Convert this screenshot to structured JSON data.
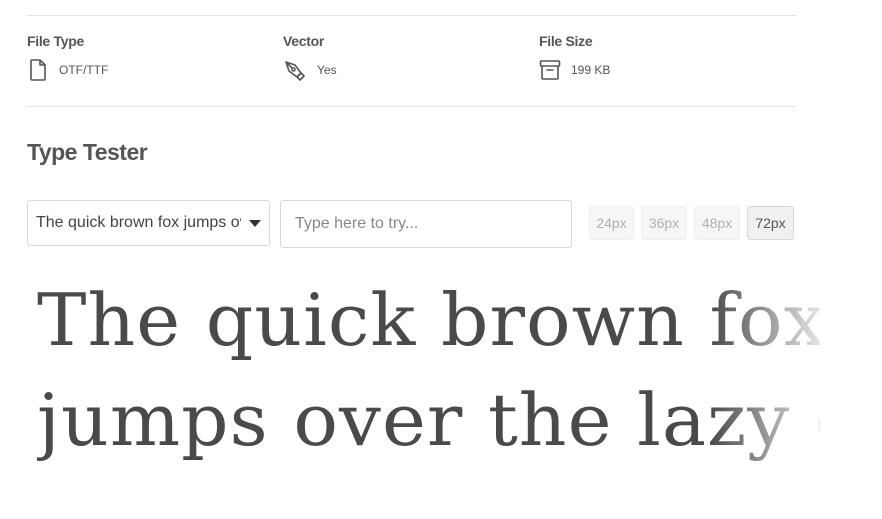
{
  "meta": {
    "file_type": {
      "label": "File Type",
      "value": "OTF/TTF",
      "icon": "file-icon"
    },
    "vector": {
      "label": "Vector",
      "value": "Yes",
      "icon": "pen-tool-icon"
    },
    "file_size": {
      "label": "File Size",
      "value": "199 KB",
      "icon": "archive-box-icon"
    }
  },
  "type_tester": {
    "title": "Type Tester",
    "sample_select": {
      "selected": "The quick brown fox jumps over the lazy dog"
    },
    "try_input": {
      "placeholder": "Type here to try...",
      "value": ""
    },
    "sizes": [
      {
        "label": "24px",
        "active": false
      },
      {
        "label": "36px",
        "active": false
      },
      {
        "label": "48px",
        "active": false
      },
      {
        "label": "72px",
        "active": true
      }
    ],
    "preview": {
      "line1": "The quick brown fox",
      "line2": "jumps over the lazy dog"
    }
  },
  "colors": {
    "text": "#555555",
    "divider": "#e3e3e3",
    "preview_text": "#4a4a4a"
  }
}
